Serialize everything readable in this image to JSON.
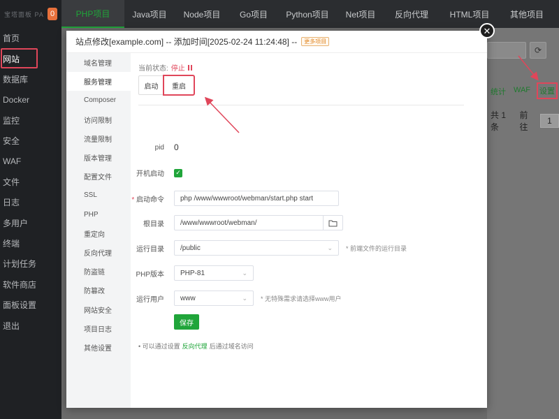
{
  "sidebar": {
    "logo_text": "宝塔面板 PANEL",
    "badge": "0",
    "items": [
      {
        "label": "首页"
      },
      {
        "label": "网站"
      },
      {
        "label": "数据库"
      },
      {
        "label": "Docker"
      },
      {
        "label": "监控"
      },
      {
        "label": "安全"
      },
      {
        "label": "WAF"
      },
      {
        "label": "文件"
      },
      {
        "label": "日志"
      },
      {
        "label": "多用户"
      },
      {
        "label": "终端"
      },
      {
        "label": "计划任务"
      },
      {
        "label": "软件商店"
      },
      {
        "label": "面板设置"
      },
      {
        "label": "退出"
      }
    ]
  },
  "topbar": {
    "tabs": [
      {
        "label": "PHP项目"
      },
      {
        "label": "Java项目"
      },
      {
        "label": "Node项目"
      },
      {
        "label": "Go项目"
      },
      {
        "label": "Python项目"
      },
      {
        "label": "Net项目"
      },
      {
        "label": "反向代理"
      },
      {
        "label": "HTML项目"
      },
      {
        "label": "其他项目"
      }
    ]
  },
  "background": {
    "actions": [
      "统计",
      "WAF",
      "设置"
    ],
    "pager_total": "共 1 条",
    "pager_goto": "前往",
    "pager_page": "1"
  },
  "modal": {
    "title": "站点修改[example.com] -- 添加时间[2025-02-24 11:24:48] --",
    "badge": "更多项目",
    "side_menu": [
      "域名管理",
      "服务管理",
      "Composer",
      "访问限制",
      "流量限制",
      "版本管理",
      "配置文件",
      "SSL",
      "PHP",
      "重定向",
      "反向代理",
      "防盗链",
      "防篡改",
      "网站安全",
      "项目日志",
      "其他设置"
    ],
    "status_label": "当前状态:",
    "status_value": "停止",
    "btn_start": "启动",
    "btn_restart": "重启",
    "form": {
      "pid_label": "pid",
      "pid_value": "0",
      "autostart_label": "开机启动",
      "start_cmd_label": "启动命令",
      "start_cmd_value": "php /www/wwwroot/webman/start.php start",
      "root_label": "根目录",
      "root_value": "/www/wwwroot/webman/",
      "run_dir_label": "运行目录",
      "run_dir_value": "/public",
      "run_dir_hint": "* 前端文件的运行目录",
      "php_label": "PHP版本",
      "php_value": "PHP-81",
      "user_label": "运行用户",
      "user_value": "www",
      "user_hint": "* 无特殊需求请选择www用户",
      "save_label": "保存"
    },
    "tip_prefix": "• 可以通过设置",
    "tip_link": "反向代理",
    "tip_suffix": "后通过域名访问"
  },
  "colors": {
    "accent": "#20a53a",
    "danger": "#e0465a",
    "sidebar_bg": "#1f2124"
  }
}
